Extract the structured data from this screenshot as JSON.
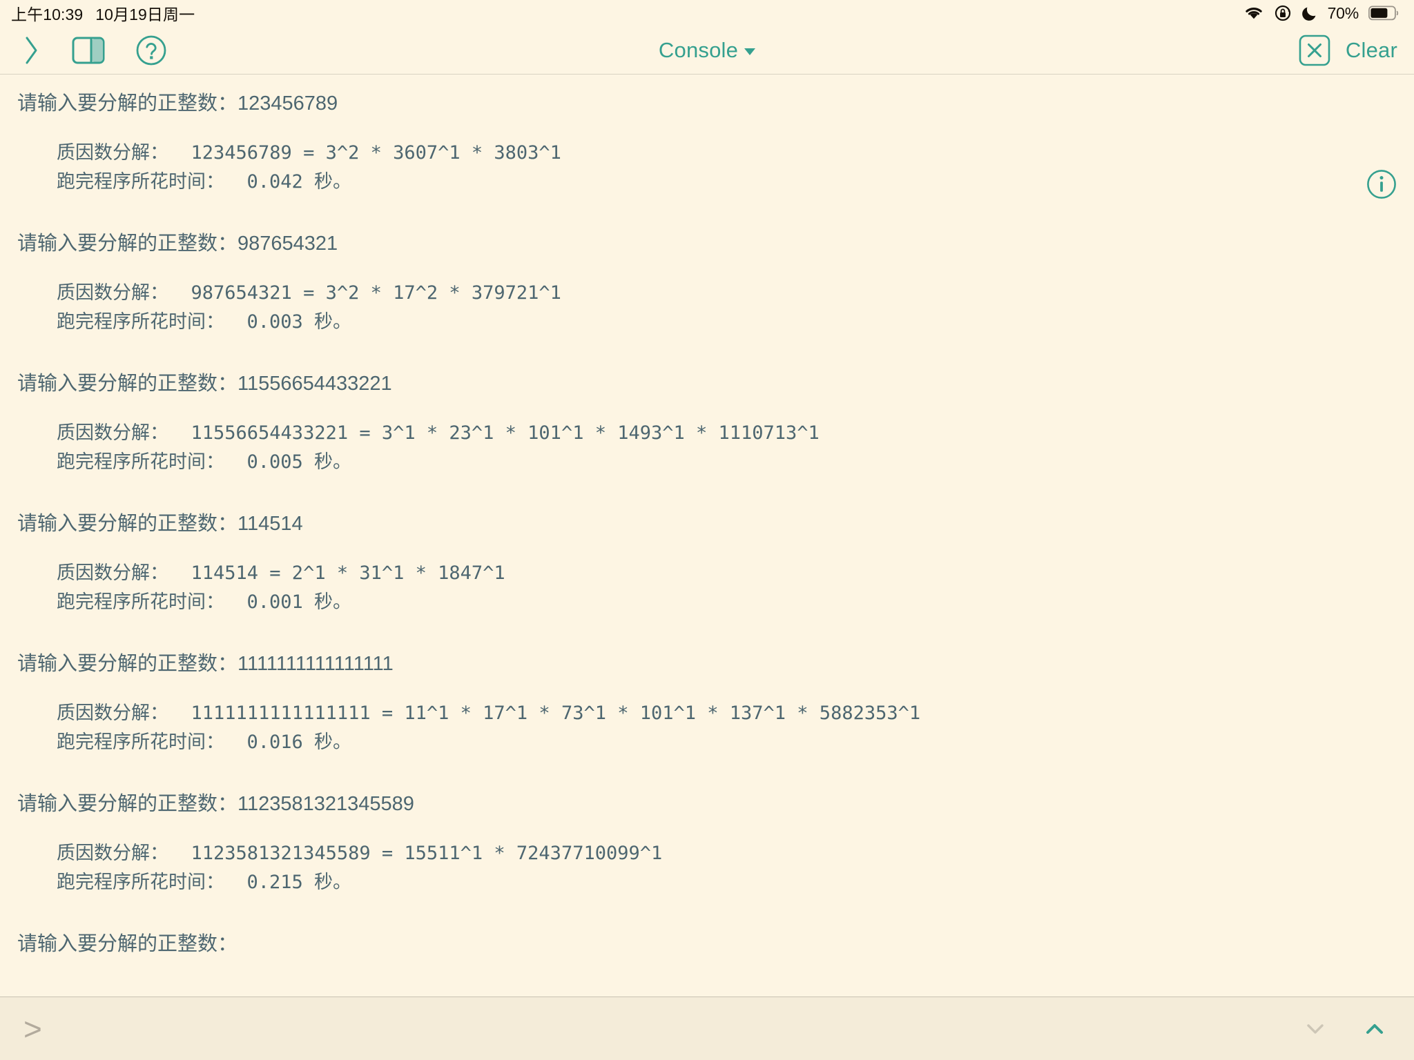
{
  "status_bar": {
    "time": "上午10:39",
    "date": "10月19日周一",
    "battery_percent": "70%",
    "icons": [
      "wifi-icon",
      "rotation-lock-icon",
      "do-not-disturb-moon-icon",
      "battery-icon"
    ]
  },
  "toolbar": {
    "run_label": "〉",
    "title": "Console",
    "clear_label": "Clear",
    "accent_color": "#35a08f",
    "icons": [
      "chevron-right-run-icon",
      "split-view-icon",
      "help-question-icon",
      "close-x-icon"
    ]
  },
  "console": {
    "info_icon": "info-circle-icon",
    "text_color": "#4d6670",
    "background_color": "#fdf5e3",
    "prompt_text": "请输入要分解的正整数：",
    "blocks": [
      {
        "prompt": "请输入要分解的正整数：123456789",
        "factor_line": "质因数分解：  123456789 = 3^2 * 3607^1 * 3803^1",
        "time_line": "跑完程序所花时间：  0.042 秒。",
        "input": "123456789",
        "factors": "3^2 * 3607^1 * 3803^1",
        "elapsed_seconds": "0.042"
      },
      {
        "prompt": "请输入要分解的正整数：987654321",
        "factor_line": "质因数分解：  987654321 = 3^2 * 17^2 * 379721^1",
        "time_line": "跑完程序所花时间：  0.003 秒。",
        "input": "987654321",
        "factors": "3^2 * 17^2 * 379721^1",
        "elapsed_seconds": "0.003"
      },
      {
        "prompt": "请输入要分解的正整数：11556654433221",
        "factor_line": "质因数分解：  11556654433221 = 3^1 * 23^1 * 101^1 * 1493^1 * 1110713^1",
        "time_line": "跑完程序所花时间：  0.005 秒。",
        "input": "11556654433221",
        "factors": "3^1 * 23^1 * 101^1 * 1493^1 * 1110713^1",
        "elapsed_seconds": "0.005"
      },
      {
        "prompt": "请输入要分解的正整数：114514",
        "factor_line": "质因数分解：  114514 = 2^1 * 31^1 * 1847^1",
        "time_line": "跑完程序所花时间：  0.001 秒。",
        "input": "114514",
        "factors": "2^1 * 31^1 * 1847^1",
        "elapsed_seconds": "0.001"
      },
      {
        "prompt": "请输入要分解的正整数：1111111111111111",
        "factor_line": "质因数分解：  1111111111111111 = 11^1 * 17^1 * 73^1 * 101^1 * 137^1 * 5882353^1",
        "time_line": "跑完程序所花时间：  0.016 秒。",
        "input": "1111111111111111",
        "factors": "11^1 * 17^1 * 73^1 * 101^1 * 137^1 * 5882353^1",
        "elapsed_seconds": "0.016"
      },
      {
        "prompt": "请输入要分解的正整数：1123581321345589",
        "factor_line": "质因数分解：  1123581321345589 = 15511^1 * 72437710099^1",
        "time_line": "跑完程序所花时间：  0.215 秒。",
        "input": "1123581321345589",
        "factors": "15511^1 * 72437710099^1",
        "elapsed_seconds": "0.215"
      }
    ],
    "final_prompt": "请输入要分解的正整数："
  },
  "input_bar": {
    "chevron": ">",
    "value": "",
    "placeholder": "",
    "prev_icon": "chevron-down-icon",
    "next_icon": "chevron-up-icon",
    "prev_enabled_color": "#cdc6b6",
    "next_enabled_color": "#35a08f"
  }
}
